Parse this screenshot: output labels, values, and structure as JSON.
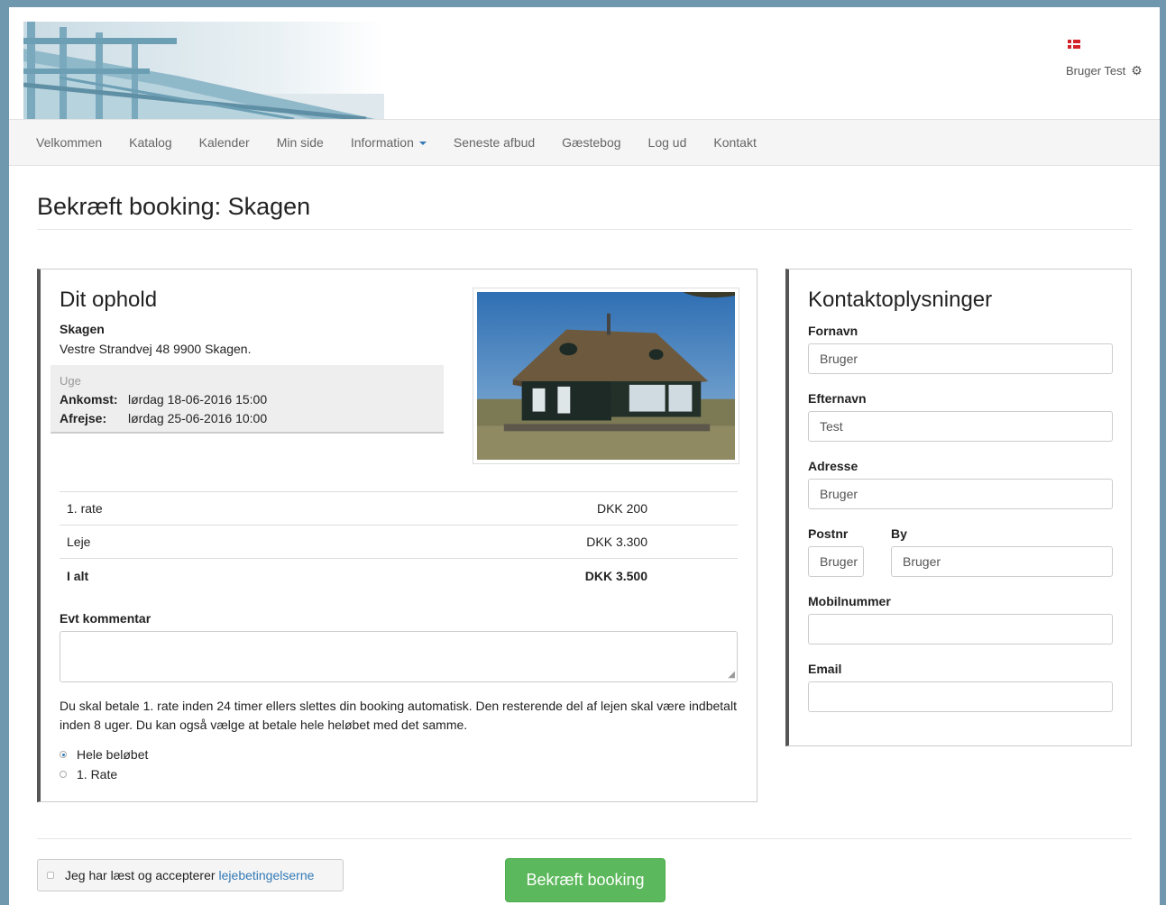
{
  "header": {
    "user_name": "Bruger Test",
    "flag_icon": "denmark-flag-icon",
    "settings_icon": "gear-icon"
  },
  "nav": {
    "items": [
      "Velkommen",
      "Katalog",
      "Kalender",
      "Min side",
      "Information",
      "Seneste afbud",
      "Gæstebog",
      "Log ud",
      "Kontakt"
    ]
  },
  "page": {
    "title": "Bekræft booking: Skagen"
  },
  "stay": {
    "heading": "Dit ophold",
    "property_name": "Skagen",
    "address": "Vestre Strandvej 48 9900 Skagen.",
    "period_label": "Uge",
    "arrival_label": "Ankomst:",
    "arrival_value": "lørdag 18-06-2016 15:00",
    "departure_label": "Afrejse:",
    "departure_value": "lørdag 25-06-2016 10:00"
  },
  "prices": {
    "rows": [
      {
        "label": "1. rate",
        "amount": "DKK 200"
      },
      {
        "label": "Leje",
        "amount": "DKK 3.300"
      },
      {
        "label": "I alt",
        "amount": "DKK 3.500"
      }
    ]
  },
  "comment": {
    "label": "Evt kommentar",
    "value": ""
  },
  "payment": {
    "info": "Du skal betale 1. rate inden 24 timer ellers slettes din booking automatisk. Den resterende del af lejen skal være indbetalt inden 8 uger. Du kan også vælge at betale hele heløbet med det samme.",
    "option_full": "Hele beløbet",
    "option_rate": "1. Rate",
    "selected": "Hele beløbet"
  },
  "contact": {
    "heading": "Kontaktoplysninger",
    "first_name_label": "Fornavn",
    "first_name_value": "Bruger",
    "last_name_label": "Efternavn",
    "last_name_value": "Test",
    "address_label": "Adresse",
    "address_value": "Bruger",
    "zip_label": "Postnr",
    "zip_value": "Bruger",
    "city_label": "By",
    "city_value": "Bruger",
    "mobile_label": "Mobilnummer",
    "mobile_value": "",
    "email_label": "Email",
    "email_value": ""
  },
  "footer": {
    "terms_text": "Jeg har læst og accepterer",
    "terms_link": "lejebetingelserne",
    "confirm_label": "Bekræft booking"
  },
  "colors": {
    "accent": "#337ab7",
    "confirm_button": "#5cb85c"
  }
}
